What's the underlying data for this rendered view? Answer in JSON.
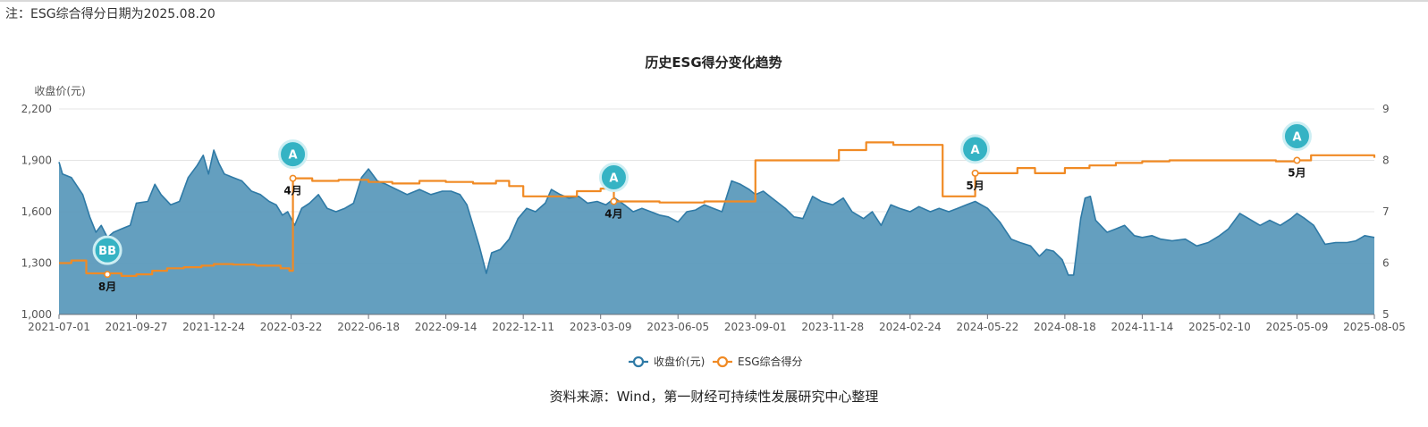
{
  "note": "注：ESG综合得分日期为2025.08.20",
  "source": "资料来源：Wind，第一财经可持续性发展研究中心整理",
  "colors": {
    "price_fill": "#5c9abc",
    "price_line": "#2f7aa6",
    "esg_line": "#f08a24",
    "pin": "#35b3c4",
    "grid": "#e4e4e4"
  },
  "chart_data": {
    "type": "line",
    "title": "历史ESG得分变化趋势",
    "ylabel_left": "收盘价(元)",
    "ylabel_right": "",
    "y_left": {
      "min": 1000,
      "max": 2200,
      "ticks": [
        "1,000",
        "1,300",
        "1,600",
        "1,900",
        "2,200"
      ]
    },
    "y_right": {
      "min": 5,
      "max": 9,
      "ticks": [
        "5",
        "6",
        "7",
        "8",
        "9"
      ]
    },
    "x_range": [
      "2021-07-01",
      "2025-08-05"
    ],
    "x_ticks": [
      "2021-07-01",
      "2021-09-27",
      "2021-12-24",
      "2022-03-22",
      "2022-06-18",
      "2022-09-14",
      "2022-12-11",
      "2023-03-09",
      "2023-06-05",
      "2023-09-01",
      "2023-11-28",
      "2024-02-24",
      "2024-05-22",
      "2024-08-18",
      "2024-11-14",
      "2025-02-10",
      "2025-05-09",
      "2025-08-05"
    ],
    "legend": [
      "收盘价(元)",
      "ESG综合得分"
    ],
    "legend_position": "bottom-center",
    "grid": true,
    "series": [
      {
        "name": "收盘价(元)",
        "type": "area",
        "points": [
          [
            "2021-07-01",
            1890
          ],
          [
            "2021-07-05",
            1820
          ],
          [
            "2021-07-15",
            1800
          ],
          [
            "2021-07-28",
            1700
          ],
          [
            "2021-08-05",
            1570
          ],
          [
            "2021-08-12",
            1480
          ],
          [
            "2021-08-18",
            1520
          ],
          [
            "2021-08-25",
            1450
          ],
          [
            "2021-09-01",
            1480
          ],
          [
            "2021-09-10",
            1500
          ],
          [
            "2021-09-20",
            1520
          ],
          [
            "2021-09-27",
            1650
          ],
          [
            "2021-10-10",
            1660
          ],
          [
            "2021-10-18",
            1760
          ],
          [
            "2021-10-25",
            1700
          ],
          [
            "2021-11-05",
            1640
          ],
          [
            "2021-11-15",
            1660
          ],
          [
            "2021-11-25",
            1800
          ],
          [
            "2021-12-05",
            1870
          ],
          [
            "2021-12-12",
            1930
          ],
          [
            "2021-12-18",
            1820
          ],
          [
            "2021-12-24",
            1960
          ],
          [
            "2021-12-30",
            1880
          ],
          [
            "2022-01-05",
            1820
          ],
          [
            "2022-01-15",
            1800
          ],
          [
            "2022-01-25",
            1780
          ],
          [
            "2022-02-05",
            1720
          ],
          [
            "2022-02-15",
            1700
          ],
          [
            "2022-02-25",
            1660
          ],
          [
            "2022-03-05",
            1640
          ],
          [
            "2022-03-12",
            1580
          ],
          [
            "2022-03-18",
            1600
          ],
          [
            "2022-03-26",
            1520
          ],
          [
            "2022-04-03",
            1620
          ],
          [
            "2022-04-12",
            1650
          ],
          [
            "2022-04-22",
            1700
          ],
          [
            "2022-05-02",
            1620
          ],
          [
            "2022-05-12",
            1600
          ],
          [
            "2022-05-22",
            1620
          ],
          [
            "2022-06-01",
            1650
          ],
          [
            "2022-06-10",
            1800
          ],
          [
            "2022-06-18",
            1850
          ],
          [
            "2022-06-28",
            1780
          ],
          [
            "2022-07-08",
            1760
          ],
          [
            "2022-07-20",
            1730
          ],
          [
            "2022-08-01",
            1700
          ],
          [
            "2022-08-15",
            1730
          ],
          [
            "2022-08-28",
            1700
          ],
          [
            "2022-09-10",
            1720
          ],
          [
            "2022-09-20",
            1720
          ],
          [
            "2022-09-30",
            1700
          ],
          [
            "2022-10-08",
            1640
          ],
          [
            "2022-10-15",
            1520
          ],
          [
            "2022-10-22",
            1400
          ],
          [
            "2022-10-30",
            1240
          ],
          [
            "2022-11-05",
            1360
          ],
          [
            "2022-11-15",
            1380
          ],
          [
            "2022-11-25",
            1440
          ],
          [
            "2022-12-05",
            1560
          ],
          [
            "2022-12-15",
            1620
          ],
          [
            "2022-12-25",
            1600
          ],
          [
            "2023-01-05",
            1650
          ],
          [
            "2023-01-12",
            1730
          ],
          [
            "2023-01-22",
            1700
          ],
          [
            "2023-02-01",
            1680
          ],
          [
            "2023-02-12",
            1690
          ],
          [
            "2023-02-22",
            1650
          ],
          [
            "2023-03-05",
            1660
          ],
          [
            "2023-03-15",
            1640
          ],
          [
            "2023-03-25",
            1680
          ],
          [
            "2023-04-05",
            1640
          ],
          [
            "2023-04-15",
            1600
          ],
          [
            "2023-04-25",
            1620
          ],
          [
            "2023-05-05",
            1600
          ],
          [
            "2023-05-15",
            1580
          ],
          [
            "2023-05-25",
            1570
          ],
          [
            "2023-06-05",
            1540
          ],
          [
            "2023-06-15",
            1600
          ],
          [
            "2023-06-25",
            1610
          ],
          [
            "2023-07-05",
            1640
          ],
          [
            "2023-07-15",
            1620
          ],
          [
            "2023-07-25",
            1600
          ],
          [
            "2023-08-05",
            1780
          ],
          [
            "2023-08-15",
            1760
          ],
          [
            "2023-08-25",
            1730
          ],
          [
            "2023-09-01",
            1700
          ],
          [
            "2023-09-10",
            1720
          ],
          [
            "2023-09-20",
            1680
          ],
          [
            "2023-10-05",
            1620
          ],
          [
            "2023-10-15",
            1570
          ],
          [
            "2023-10-25",
            1560
          ],
          [
            "2023-11-05",
            1690
          ],
          [
            "2023-11-15",
            1660
          ],
          [
            "2023-11-28",
            1640
          ],
          [
            "2023-12-10",
            1680
          ],
          [
            "2023-12-20",
            1600
          ],
          [
            "2024-01-02",
            1560
          ],
          [
            "2024-01-12",
            1600
          ],
          [
            "2024-01-22",
            1520
          ],
          [
            "2024-02-02",
            1640
          ],
          [
            "2024-02-12",
            1620
          ],
          [
            "2024-02-24",
            1600
          ],
          [
            "2024-03-05",
            1630
          ],
          [
            "2024-03-18",
            1600
          ],
          [
            "2024-03-28",
            1620
          ],
          [
            "2024-04-08",
            1600
          ],
          [
            "2024-04-18",
            1620
          ],
          [
            "2024-04-28",
            1640
          ],
          [
            "2024-05-08",
            1660
          ],
          [
            "2024-05-22",
            1620
          ],
          [
            "2024-06-05",
            1540
          ],
          [
            "2024-06-18",
            1440
          ],
          [
            "2024-06-28",
            1420
          ],
          [
            "2024-07-10",
            1400
          ],
          [
            "2024-07-20",
            1340
          ],
          [
            "2024-07-28",
            1380
          ],
          [
            "2024-08-05",
            1370
          ],
          [
            "2024-08-15",
            1320
          ],
          [
            "2024-08-22",
            1230
          ],
          [
            "2024-08-28",
            1230
          ],
          [
            "2024-09-05",
            1560
          ],
          [
            "2024-09-10",
            1680
          ],
          [
            "2024-09-16",
            1690
          ],
          [
            "2024-09-22",
            1550
          ],
          [
            "2024-10-05",
            1480
          ],
          [
            "2024-10-15",
            1500
          ],
          [
            "2024-10-25",
            1520
          ],
          [
            "2024-11-05",
            1460
          ],
          [
            "2024-11-14",
            1450
          ],
          [
            "2024-11-25",
            1460
          ],
          [
            "2024-12-05",
            1440
          ],
          [
            "2024-12-18",
            1430
          ],
          [
            "2025-01-02",
            1440
          ],
          [
            "2025-01-15",
            1400
          ],
          [
            "2025-01-28",
            1420
          ],
          [
            "2025-02-10",
            1460
          ],
          [
            "2025-02-20",
            1500
          ],
          [
            "2025-03-05",
            1590
          ],
          [
            "2025-03-15",
            1560
          ],
          [
            "2025-03-28",
            1520
          ],
          [
            "2025-04-08",
            1550
          ],
          [
            "2025-04-20",
            1520
          ],
          [
            "2025-05-02",
            1560
          ],
          [
            "2025-05-09",
            1590
          ],
          [
            "2025-05-18",
            1560
          ],
          [
            "2025-05-28",
            1520
          ],
          [
            "2025-06-10",
            1410
          ],
          [
            "2025-06-22",
            1420
          ],
          [
            "2025-07-05",
            1420
          ],
          [
            "2025-07-15",
            1430
          ],
          [
            "2025-07-25",
            1460
          ],
          [
            "2025-08-05",
            1450
          ]
        ]
      },
      {
        "name": "ESG综合得分",
        "type": "line",
        "points": [
          [
            "2021-07-01",
            6.0
          ],
          [
            "2021-07-15",
            6.05
          ],
          [
            "2021-08-01",
            5.8
          ],
          [
            "2021-08-25",
            5.8
          ],
          [
            "2021-09-10",
            5.75
          ],
          [
            "2021-09-27",
            5.78
          ],
          [
            "2021-10-15",
            5.85
          ],
          [
            "2021-11-01",
            5.9
          ],
          [
            "2021-11-20",
            5.92
          ],
          [
            "2021-12-10",
            5.95
          ],
          [
            "2021-12-24",
            5.98
          ],
          [
            "2022-01-15",
            5.97
          ],
          [
            "2022-02-10",
            5.95
          ],
          [
            "2022-03-10",
            5.9
          ],
          [
            "2022-03-20",
            5.85
          ],
          [
            "2022-03-24",
            7.65
          ],
          [
            "2022-04-15",
            7.6
          ],
          [
            "2022-05-15",
            7.62
          ],
          [
            "2022-06-18",
            7.58
          ],
          [
            "2022-07-15",
            7.55
          ],
          [
            "2022-08-15",
            7.6
          ],
          [
            "2022-09-14",
            7.58
          ],
          [
            "2022-10-15",
            7.55
          ],
          [
            "2022-11-10",
            7.6
          ],
          [
            "2022-11-25",
            7.5
          ],
          [
            "2022-12-11",
            7.3
          ],
          [
            "2023-01-15",
            7.3
          ],
          [
            "2023-02-10",
            7.4
          ],
          [
            "2023-03-09",
            7.45
          ],
          [
            "2023-03-24",
            7.2
          ],
          [
            "2023-04-15",
            7.2
          ],
          [
            "2023-05-15",
            7.18
          ],
          [
            "2023-06-05",
            7.18
          ],
          [
            "2023-07-05",
            7.2
          ],
          [
            "2023-08-05",
            7.2
          ],
          [
            "2023-08-28",
            7.2
          ],
          [
            "2023-09-01",
            8.0
          ],
          [
            "2023-10-15",
            8.0
          ],
          [
            "2023-11-28",
            8.0
          ],
          [
            "2023-12-05",
            8.2
          ],
          [
            "2023-12-25",
            8.2
          ],
          [
            "2024-01-05",
            8.35
          ],
          [
            "2024-02-05",
            8.3
          ],
          [
            "2024-02-24",
            8.3
          ],
          [
            "2024-03-25",
            8.3
          ],
          [
            "2024-04-01",
            7.3
          ],
          [
            "2024-04-25",
            7.3
          ],
          [
            "2024-05-01",
            7.3
          ],
          [
            "2024-05-08",
            7.75
          ],
          [
            "2024-05-22",
            7.75
          ],
          [
            "2024-06-15",
            7.75
          ],
          [
            "2024-06-25",
            7.85
          ],
          [
            "2024-07-15",
            7.75
          ],
          [
            "2024-08-18",
            7.85
          ],
          [
            "2024-09-15",
            7.9
          ],
          [
            "2024-10-15",
            7.95
          ],
          [
            "2024-11-14",
            7.98
          ],
          [
            "2024-12-15",
            8.0
          ],
          [
            "2025-01-15",
            8.0
          ],
          [
            "2025-02-10",
            8.0
          ],
          [
            "2025-03-15",
            8.0
          ],
          [
            "2025-04-15",
            7.98
          ],
          [
            "2025-05-05",
            7.98
          ],
          [
            "2025-05-09",
            8.0
          ],
          [
            "2025-05-25",
            8.1
          ],
          [
            "2025-06-15",
            8.1
          ],
          [
            "2025-07-15",
            8.1
          ],
          [
            "2025-08-05",
            8.05
          ]
        ]
      }
    ],
    "annotations": [
      {
        "date": "2021-08-25",
        "esg": 5.78,
        "grade": "BB",
        "label": "8月"
      },
      {
        "date": "2022-03-24",
        "esg": 7.65,
        "grade": "A",
        "label": "4月"
      },
      {
        "date": "2023-03-24",
        "esg": 7.2,
        "grade": "A",
        "label": "4月"
      },
      {
        "date": "2024-05-08",
        "esg": 7.75,
        "grade": "A",
        "label": "5月"
      },
      {
        "date": "2025-05-09",
        "esg": 8.0,
        "grade": "A",
        "label": "5月"
      }
    ]
  }
}
